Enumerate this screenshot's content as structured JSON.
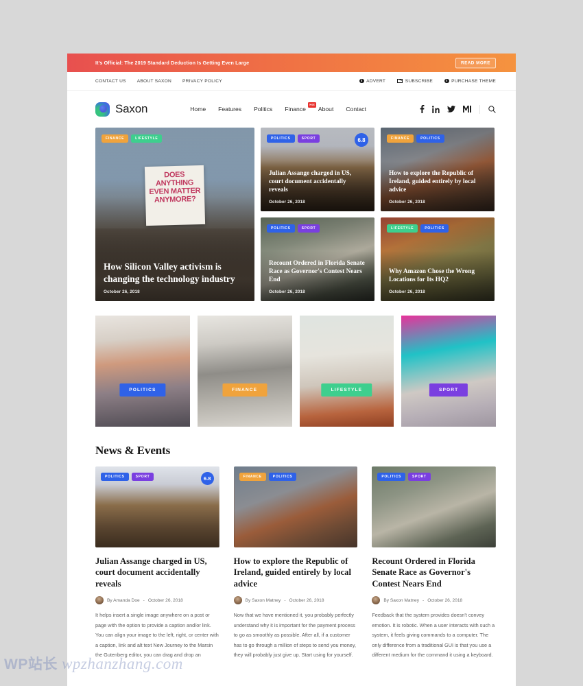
{
  "promo": {
    "text": "It's Official: The 2019 Standard Deduction Is Getting Even Large",
    "button": "READ MORE"
  },
  "utility": {
    "left_links": [
      "CONTACT US",
      "ABOUT SAXON",
      "PRIVACY POLICY"
    ],
    "right_links": [
      {
        "label": "ADVERT",
        "icon": "info-icon"
      },
      {
        "label": "SUBSCRIBE",
        "icon": "mail-icon"
      },
      {
        "label": "PURCHASE THEME",
        "icon": "info-icon"
      }
    ]
  },
  "header": {
    "brand": "Saxon",
    "nav": [
      {
        "label": "Home",
        "badge": ""
      },
      {
        "label": "Features",
        "badge": ""
      },
      {
        "label": "Politics",
        "badge": ""
      },
      {
        "label": "Finance",
        "badge": "Hot"
      },
      {
        "label": "About",
        "badge": ""
      },
      {
        "label": "Contact",
        "badge": ""
      }
    ],
    "social": [
      "facebook-icon",
      "linkedin-icon",
      "twitter-icon",
      "medium-icon",
      "search-icon"
    ]
  },
  "hero": {
    "featured": {
      "tags": [
        "FINANCE",
        "LIFESTYLE"
      ],
      "title": "How Silicon Valley activism is changing the technology industry",
      "date": "October 26, 2018",
      "sign_text": "DOES ANYTHING EVEN MATTER ANYMORE?"
    },
    "cards": [
      {
        "tags": [
          "POLITICS",
          "SPORT"
        ],
        "score": "6.8",
        "title": "Julian Assange charged in US, court document accidentally reveals",
        "date": "October 26, 2018"
      },
      {
        "tags": [
          "FINANCE",
          "POLITICS"
        ],
        "score": "",
        "title": "How to explore the Republic of Ireland, guided entirely by local advice",
        "date": "October 26, 2018"
      },
      {
        "tags": [
          "POLITICS",
          "SPORT"
        ],
        "score": "",
        "title": "Recount Ordered in Florida Senate Race as Governor's Contest Nears End",
        "date": "October 26, 2018"
      },
      {
        "tags": [
          "LIFESTYLE",
          "POLITICS"
        ],
        "score": "",
        "title": "Why Amazon Chose the Wrong Locations for Its HQ2",
        "date": "October 26, 2018"
      }
    ]
  },
  "categories": [
    {
      "label": "POLITICS",
      "color": "#2f62e8"
    },
    {
      "label": "FINANCE",
      "color": "#f0a33c"
    },
    {
      "label": "LIFESTYLE",
      "color": "#3ecf8e"
    },
    {
      "label": "SPORT",
      "color": "#7a3fe0"
    }
  ],
  "news": {
    "heading": "News & Events",
    "posts": [
      {
        "tags": [
          "POLITICS",
          "SPORT"
        ],
        "score": "6.8",
        "title": "Julian Assange charged in US, court document accidentally reveals",
        "author": "By Amanda Doe",
        "separator": "-",
        "date": "October 26, 2018",
        "excerpt": "It helps insert a single image anywhere on a post or page with the option to provide a caption and/or link. You can align your image to the left, right, or center with a caption, link and alt text New Journey to the Marsin the Gutenberg editor, you can drag and drop an"
      },
      {
        "tags": [
          "FINANCE",
          "POLITICS"
        ],
        "score": "",
        "title": "How to explore the Republic of Ireland, guided entirely by local advice",
        "author": "By Saxon Matney",
        "separator": "-",
        "date": "October 26, 2018",
        "excerpt": "Now that we have mentioned it, you probably perfectly understand why it is important for the payment process to go as smoothly as possible. After all, if a customer has to go through a million of steps to send you money, they will probably just give up. Start using for yourself."
      },
      {
        "tags": [
          "POLITICS",
          "SPORT"
        ],
        "score": "",
        "title": "Recount Ordered in Florida Senate Race as Governor's Contest Nears End",
        "author": "By Saxon Matney",
        "separator": "-",
        "date": "October 26, 2018",
        "excerpt": "Feedback that the system provides doesn't convey emotion. It is robotic. When a user interacts with such a system, it feels giving commands to a computer. The only difference from a traditional GUI is that you use a different medium for the command it using a keyboard."
      }
    ]
  },
  "watermark": {
    "cn": "WP站长",
    "en": "wpzhanzhang.com"
  }
}
